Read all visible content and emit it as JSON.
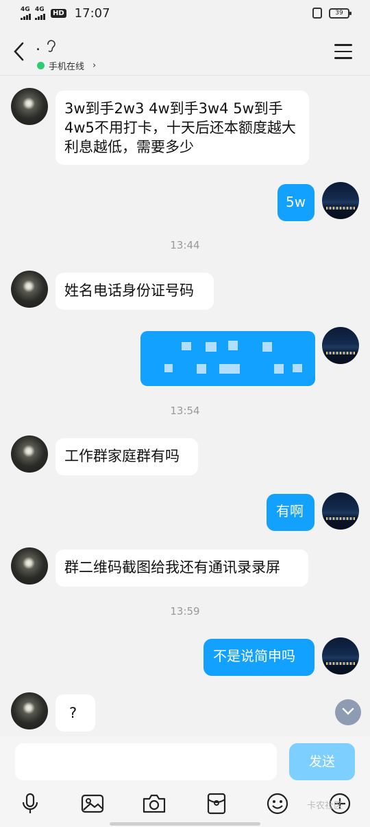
{
  "status_bar": {
    "signal1": "4G",
    "signal2": "4G",
    "hd_badge": "HD",
    "time": "17:07",
    "battery": "39"
  },
  "header": {
    "title": ".",
    "online_status": "手机在线",
    "chevron": "›"
  },
  "messages": [
    {
      "side": "left",
      "text": "3w到手2w3 4w到手3w4 5w到手4w5不用打卡，十天后还本额度越大利息越低，需要多少"
    },
    {
      "side": "right",
      "text": "5w"
    },
    {
      "timestamp": "13:44"
    },
    {
      "side": "left",
      "text": "姓名电话身份证号码"
    },
    {
      "side": "right",
      "text": "",
      "redacted": true
    },
    {
      "timestamp": "13:54"
    },
    {
      "side": "left",
      "text": "工作群家庭群有吗"
    },
    {
      "side": "right",
      "text": "有啊"
    },
    {
      "side": "left",
      "text": "群二维码截图给我还有通讯录录屏"
    },
    {
      "timestamp": "13:59"
    },
    {
      "side": "right",
      "text": "不是说简申吗"
    },
    {
      "side": "left",
      "text": "?"
    }
  ],
  "input": {
    "placeholder": "",
    "send_label": "发送"
  },
  "toolbar_icons": [
    "microphone-icon",
    "image-icon",
    "camera-icon",
    "red-packet-icon",
    "emoji-icon",
    "plus-icon"
  ],
  "watermark": "卡农社区",
  "colors": {
    "bubble_right": "#12a1ff",
    "bubble_left": "#ffffff",
    "send_button": "#7ccfff",
    "online_dot": "#2ecc71"
  }
}
